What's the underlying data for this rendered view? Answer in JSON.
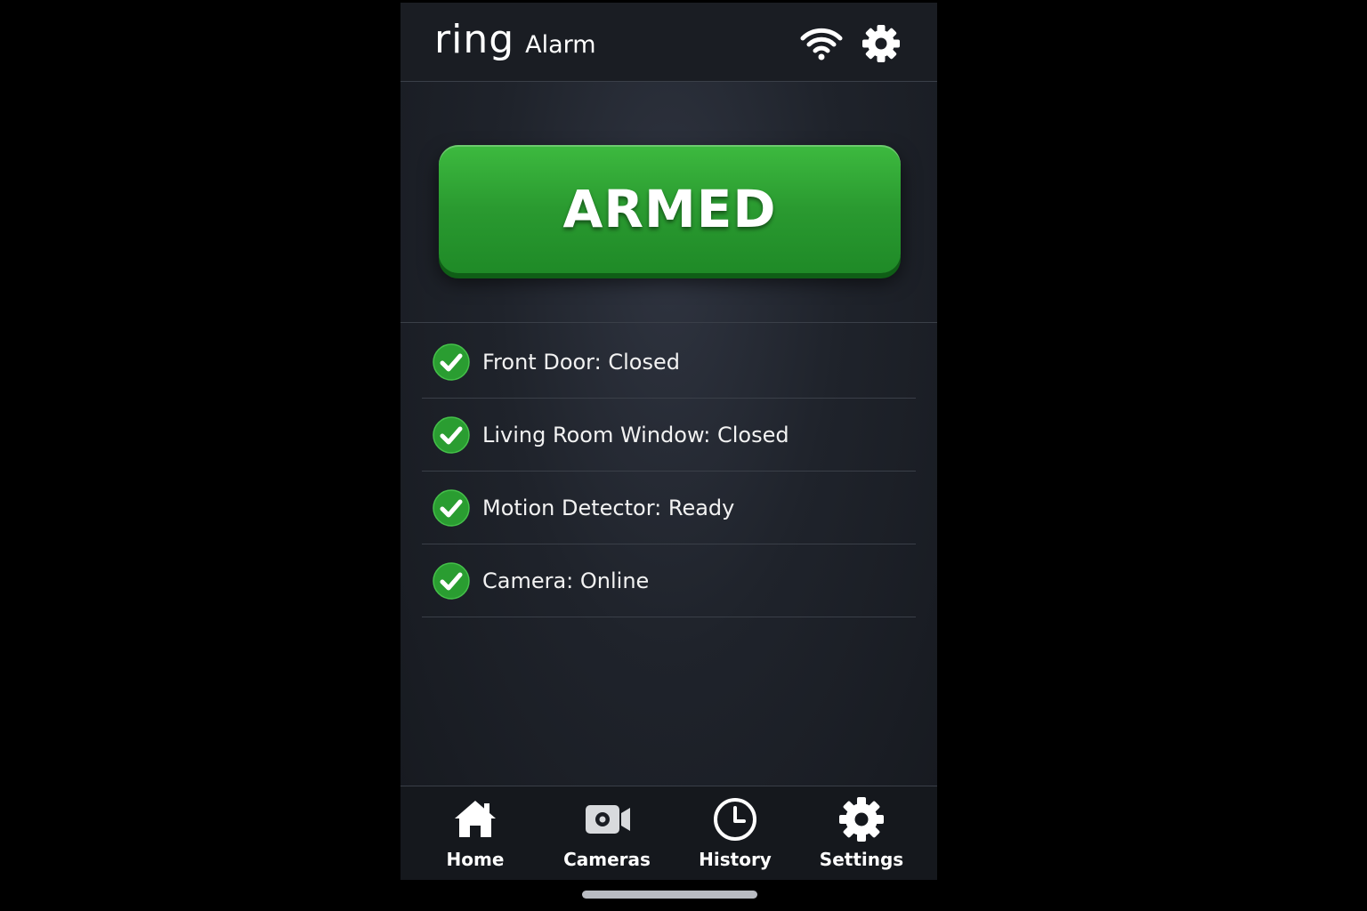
{
  "header": {
    "logo": "ring",
    "title": "Alarm",
    "wifi_icon": "wifi-icon",
    "settings_icon": "gear-icon"
  },
  "arm_button": {
    "label": "ARMED",
    "color": "#2e9e33"
  },
  "status_items": [
    {
      "icon": "check-circle-icon",
      "text": "Front Door: Closed"
    },
    {
      "icon": "check-circle-icon",
      "text": "Living Room Window: Closed"
    },
    {
      "icon": "check-circle-icon",
      "text": "Motion Detector: Ready"
    },
    {
      "icon": "check-circle-icon",
      "text": "Camera: Online"
    }
  ],
  "nav": [
    {
      "icon": "home-icon",
      "label": "Home"
    },
    {
      "icon": "camera-icon",
      "label": "Cameras"
    },
    {
      "icon": "clock-icon",
      "label": "History"
    },
    {
      "icon": "gear-icon",
      "label": "Settings"
    }
  ],
  "colors": {
    "accent_green": "#2e9e33",
    "background": "#1f232b",
    "text": "#ffffff"
  }
}
